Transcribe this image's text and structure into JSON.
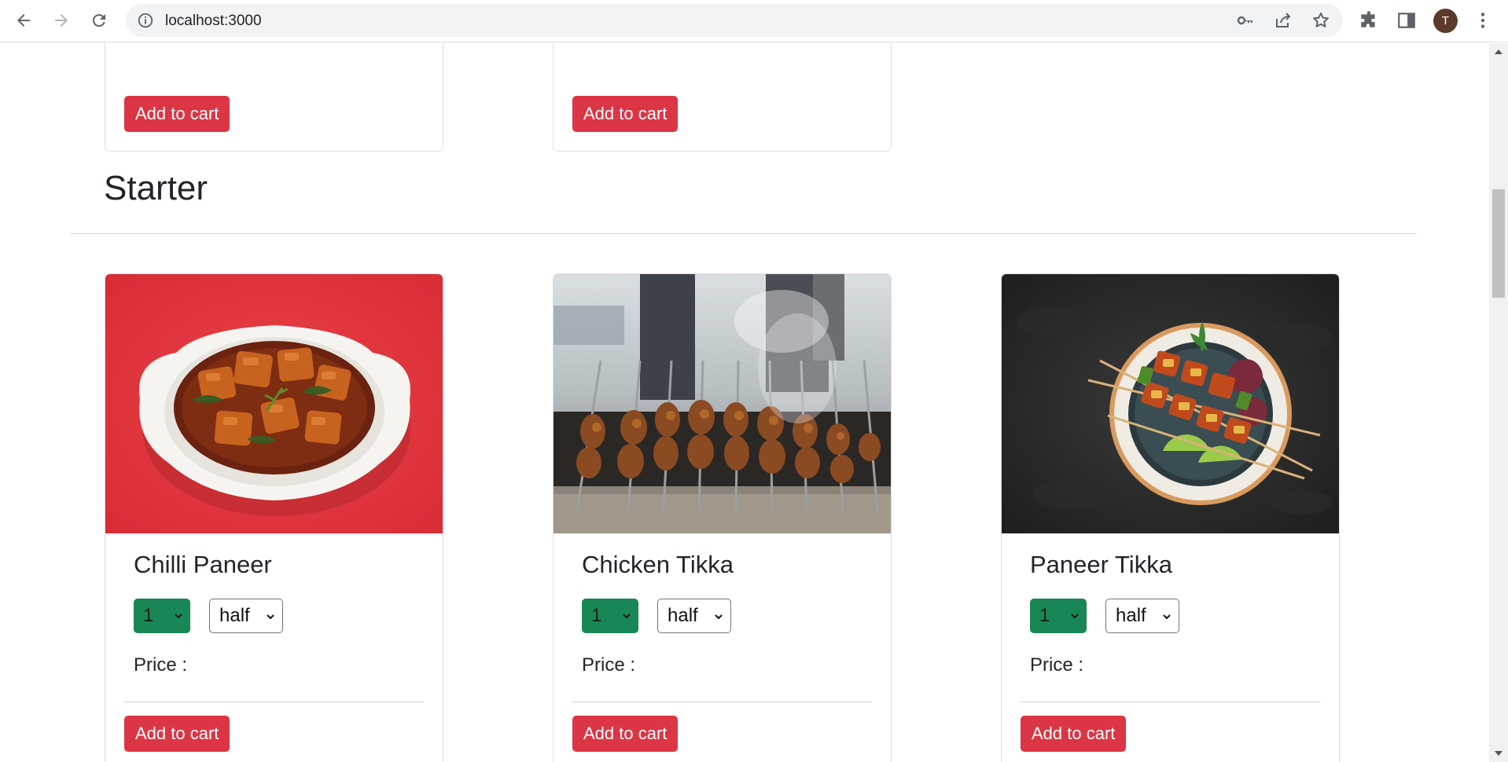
{
  "browser": {
    "url": "localhost:3000",
    "profile_initial": "T",
    "icons": [
      "back-icon",
      "forward-icon",
      "reload-icon",
      "info-icon",
      "key-icon",
      "share-icon",
      "star-icon",
      "extensions-icon",
      "side-panel-icon",
      "menu-icon"
    ]
  },
  "previous_section": {
    "cards": [
      {
        "button_label": "Add to cart"
      },
      {
        "button_label": "Add to cart"
      }
    ]
  },
  "section": {
    "heading": "Starter",
    "items": [
      {
        "name": "Chilli Paneer",
        "quantity": "1",
        "size": "half",
        "price_label": "Price :",
        "button_label": "Add to cart",
        "image": "chilli-paneer-photo"
      },
      {
        "name": "Chicken Tikka",
        "quantity": "1",
        "size": "half",
        "price_label": "Price :",
        "button_label": "Add to cart",
        "image": "chicken-tikka-photo"
      },
      {
        "name": "Paneer Tikka",
        "quantity": "1",
        "size": "half",
        "price_label": "Price :",
        "button_label": "Add to cart",
        "image": "paneer-tikka-photo"
      }
    ]
  },
  "colors": {
    "button_red": "#dc3545",
    "select_green": "#198754",
    "text_dark": "#212529"
  }
}
